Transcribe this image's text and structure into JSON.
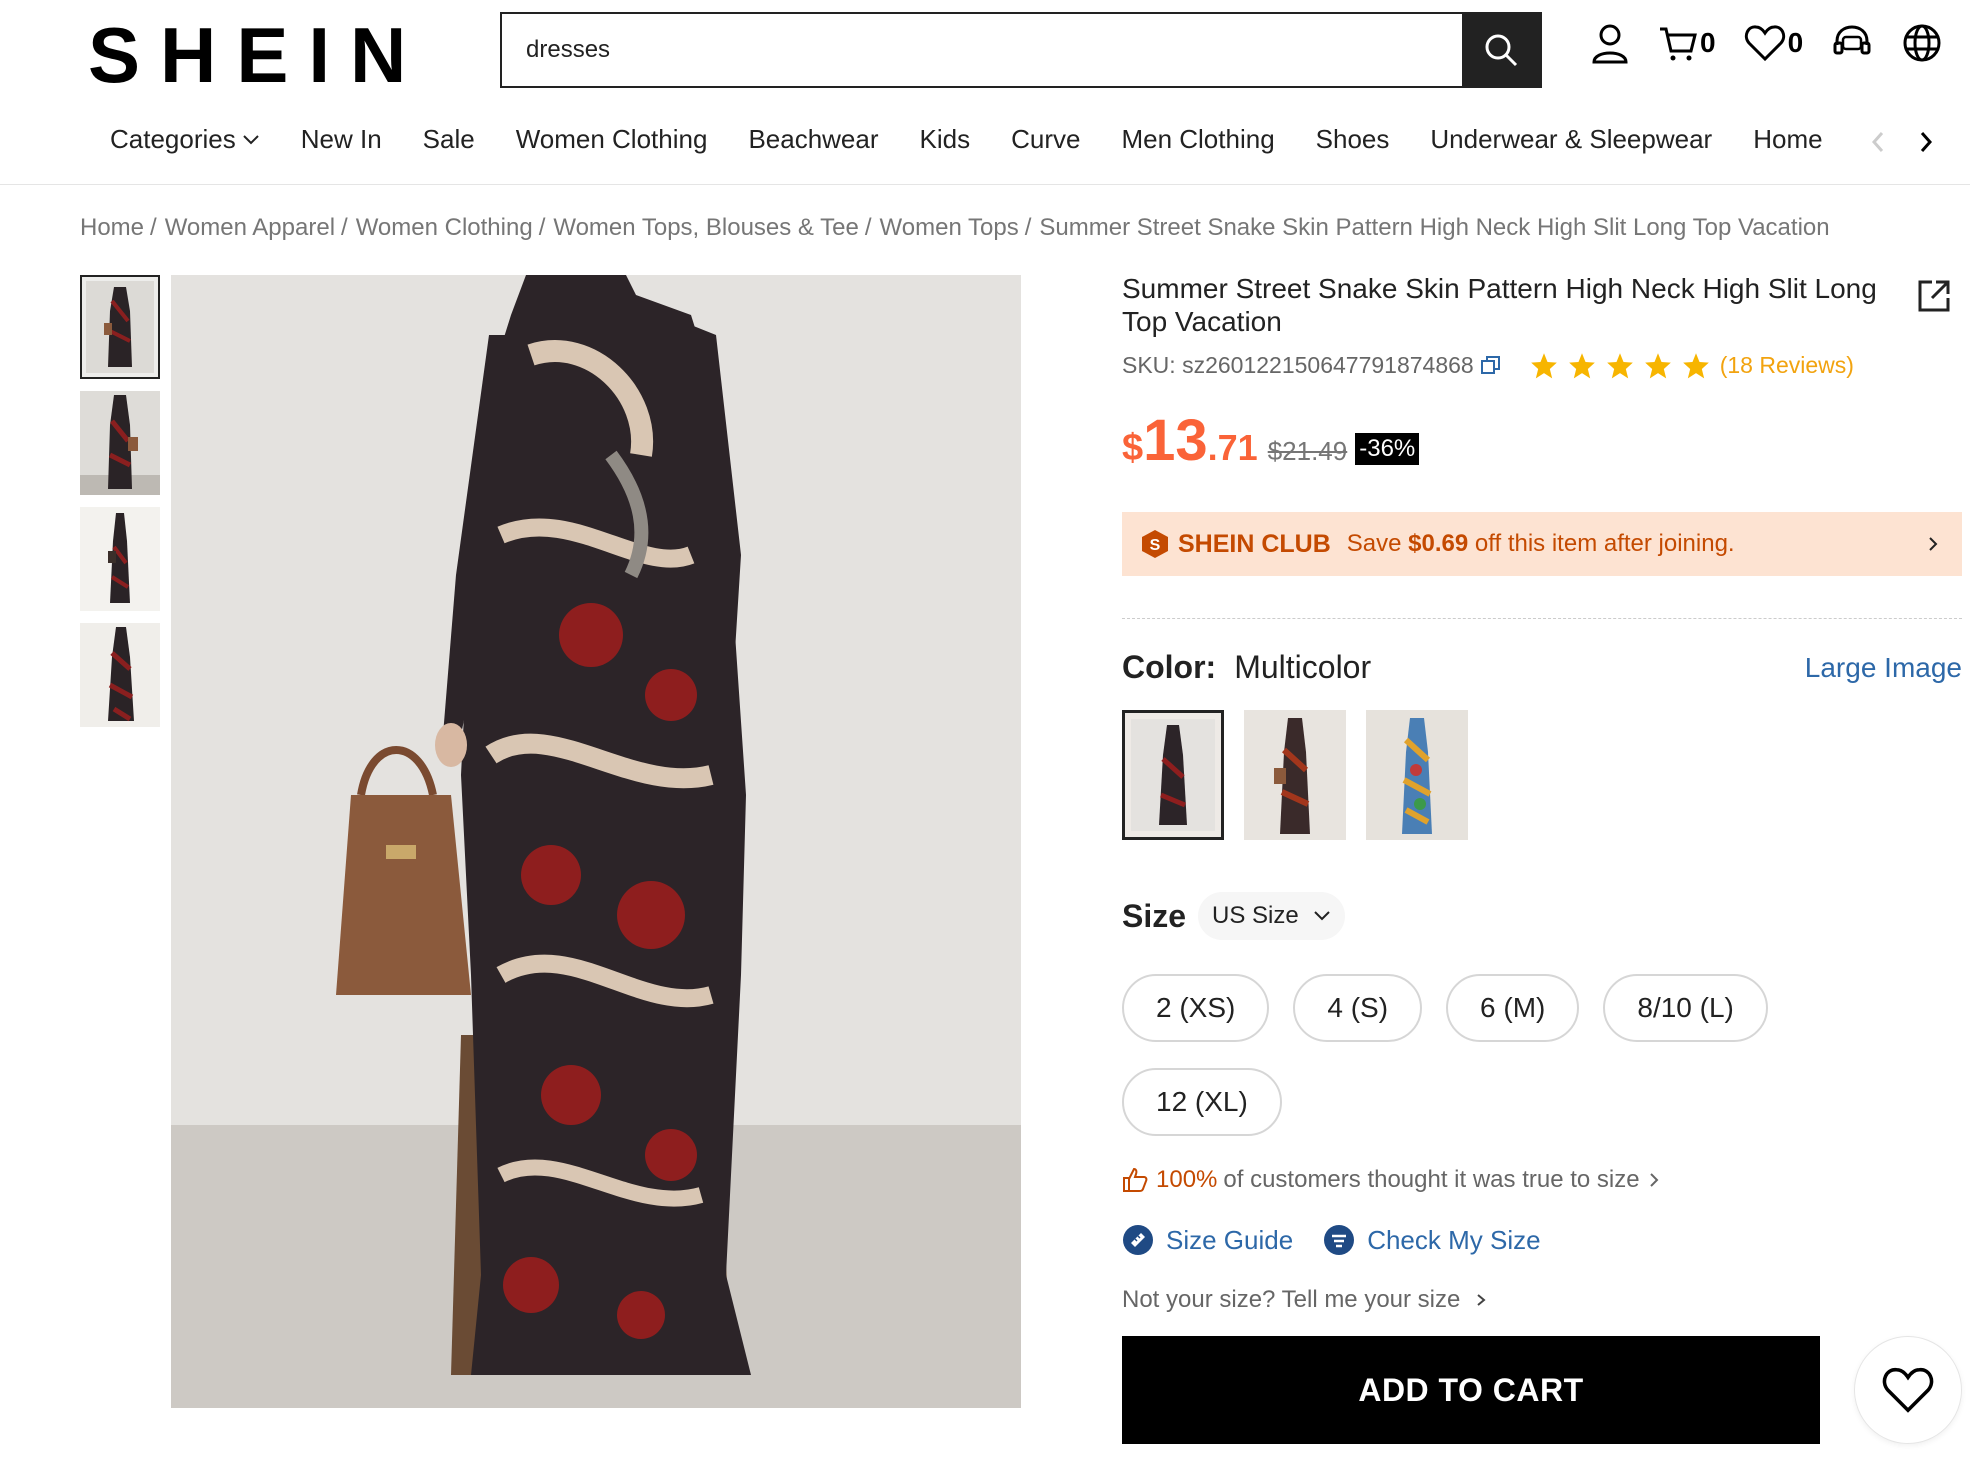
{
  "header": {
    "logo": "SHEIN",
    "search_value": "dresses",
    "cart_count": "0",
    "wishlist_count": "0"
  },
  "nav": {
    "items": [
      "Categories",
      "New In",
      "Sale",
      "Women Clothing",
      "Beachwear",
      "Kids",
      "Curve",
      "Men Clothing",
      "Shoes",
      "Underwear & Sleepwear",
      "Home"
    ]
  },
  "breadcrumb": [
    "Home",
    "Women Apparel",
    "Women Clothing",
    "Women Tops, Blouses & Tee",
    "Women Tops",
    "Summer Street Snake Skin Pattern High Neck High Slit Long Top Vacation"
  ],
  "product": {
    "title": "Summer Street Snake Skin Pattern High Neck High Slit Long Top Vacation",
    "sku": "SKU: sz2601221506477918748​68",
    "reviews": "(18 Reviews)",
    "rating": 5,
    "price_symbol": "$",
    "price_int": "13",
    "price_dec": ".71",
    "price_old": "$21.49",
    "discount": "-36%"
  },
  "club": {
    "name": "SHEIN CLUB",
    "text_before": "Save",
    "amount": "$0.69",
    "text_after": "off this item after joining."
  },
  "color": {
    "label": "Color:",
    "value": "Multicolor",
    "large_image": "Large Image"
  },
  "size": {
    "label": "Size",
    "system": "US Size",
    "options": [
      "2 (XS)",
      "4 (S)",
      "6 (M)",
      "8/10 (L)",
      "12 (XL)"
    ],
    "fit_pct": "100%",
    "fit_text": "of customers thought it was true to size",
    "size_guide": "Size Guide",
    "check_size": "Check My Size",
    "not_size": "Not your size? Tell me your size"
  },
  "actions": {
    "add_to_cart": "ADD TO CART"
  },
  "colors": {
    "accent": "#fa6338",
    "club": "#c44a01",
    "link": "#2d68a8",
    "star": "#f7b500"
  }
}
